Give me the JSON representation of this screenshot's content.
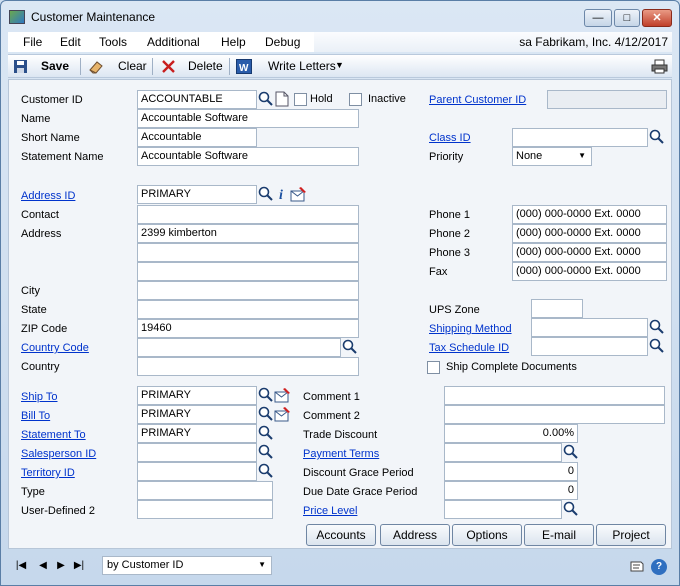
{
  "window": {
    "title": "Customer Maintenance"
  },
  "menu": {
    "items": [
      "File",
      "Edit",
      "Tools",
      "Additional",
      "Help",
      "Debug"
    ],
    "status": "sa  Fabrikam, Inc.  4/12/2017"
  },
  "toolbar": {
    "save": "Save",
    "clear": "Clear",
    "delete": "Delete",
    "write_letters": "Write Letters"
  },
  "form": {
    "customer_id": {
      "label": "Customer ID",
      "value": "ACCOUNTABLE"
    },
    "hold_label": "Hold",
    "inactive_label": "Inactive",
    "parent_customer_id_label": "Parent Customer ID",
    "name": {
      "label": "Name",
      "value": "Accountable Software"
    },
    "short_name": {
      "label": "Short Name",
      "value": "Accountable"
    },
    "statement_name": {
      "label": "Statement Name",
      "value": "Accountable Software"
    },
    "class_id_label": "Class ID",
    "priority": {
      "label": "Priority",
      "value": "None"
    },
    "address_id": {
      "label": "Address ID",
      "value": "PRIMARY"
    },
    "contact_label": "Contact",
    "address": {
      "label": "Address",
      "value": "2399 kimberton"
    },
    "city_label": "City",
    "state_label": "State",
    "zip": {
      "label": "ZIP Code",
      "value": "19460"
    },
    "country_code_label": "Country Code",
    "country_label": "Country",
    "phone1": {
      "label": "Phone 1",
      "value": "(000) 000-0000  Ext. 0000"
    },
    "phone2": {
      "label": "Phone 2",
      "value": "(000) 000-0000  Ext. 0000"
    },
    "phone3": {
      "label": "Phone 3",
      "value": "(000) 000-0000  Ext. 0000"
    },
    "fax": {
      "label": "Fax",
      "value": "(000) 000-0000  Ext. 0000"
    },
    "ups_zone_label": "UPS Zone",
    "shipping_method_label": "Shipping Method",
    "tax_schedule_id_label": "Tax Schedule ID",
    "ship_complete_label": "Ship Complete Documents",
    "ship_to": {
      "label": "Ship To",
      "value": "PRIMARY"
    },
    "bill_to": {
      "label": "Bill To",
      "value": "PRIMARY"
    },
    "statement_to": {
      "label": "Statement To",
      "value": "PRIMARY"
    },
    "salesperson_id_label": "Salesperson ID",
    "territory_id_label": "Territory ID",
    "type_label": "Type",
    "user_defined2_label": "User-Defined 2",
    "comment1_label": "Comment 1",
    "comment2_label": "Comment 2",
    "trade_discount": {
      "label": "Trade Discount",
      "value": "0.00%"
    },
    "payment_terms_label": "Payment Terms",
    "discount_grace": {
      "label": "Discount Grace Period",
      "value": "0"
    },
    "due_date_grace": {
      "label": "Due Date Grace Period",
      "value": "0"
    },
    "price_level_label": "Price Level"
  },
  "buttons": {
    "accounts": "Accounts",
    "address": "Address",
    "options": "Options",
    "email": "E-mail",
    "project": "Project"
  },
  "status": {
    "sort": "by Customer ID"
  }
}
